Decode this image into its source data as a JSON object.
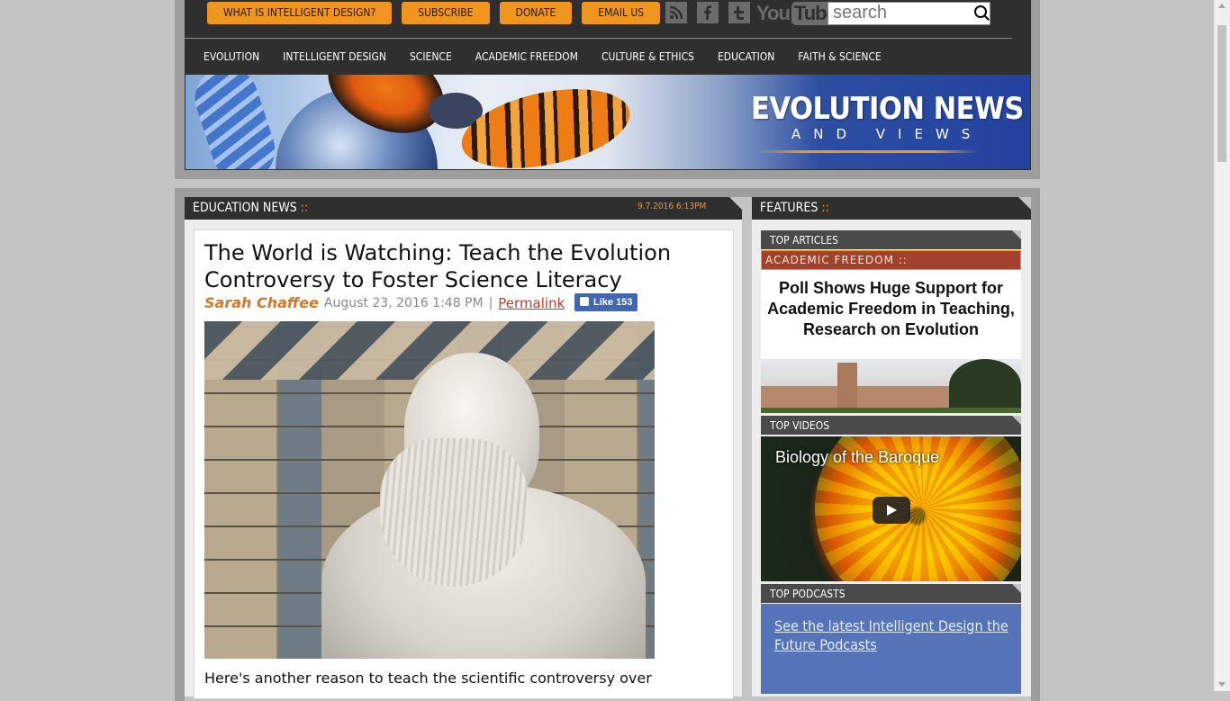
{
  "header": {
    "top_buttons": [
      "WHAT IS INTELLIGENT DESIGN?",
      "SUBSCRIBE",
      "DONATE",
      "EMAIL US"
    ],
    "social_icons": [
      "rss-icon",
      "facebook-icon",
      "twitter-icon",
      "youtube-icon"
    ],
    "youtube": {
      "you": "You",
      "tube": "Tube"
    },
    "search": {
      "placeholder": "search"
    },
    "nav": [
      "EVOLUTION",
      "INTELLIGENT DESIGN",
      "SCIENCE",
      "ACADEMIC FREEDOM",
      "CULTURE & ETHICS",
      "EDUCATION",
      "FAITH & SCIENCE"
    ],
    "banner": {
      "title": "EVOLUTION NEWS",
      "subtitle": "AND VIEWS"
    }
  },
  "main": {
    "section_title": "EDUCATION NEWS",
    "section_dots": "::",
    "timestamp": "9.7.2016 6:13PM",
    "article": {
      "title": "The World is Watching: Teach the Evolution Controversy to Foster Science Literacy",
      "author": "Sarah Chaffee",
      "date": "August 23, 2016 1:48 PM",
      "separator": "|",
      "permalink": "Permalink",
      "fb_like": "Like 153",
      "body_start": "Here's another reason to teach the scientific controversy over"
    }
  },
  "sidebar": {
    "section_title": "FEATURES",
    "section_dots": "::",
    "top_articles": {
      "label": "TOP ARTICLES",
      "category": "ACADEMIC FREEDOM ::",
      "headline": "Poll Shows Huge Support for Academic Freedom in Teaching, Research on Evolution"
    },
    "top_videos": {
      "label": "TOP VIDEOS",
      "video_title": "Biology of the Baroque"
    },
    "top_podcasts": {
      "label": "TOP PODCASTS",
      "link": "See the latest Intelligent Design the Future Podcasts"
    }
  },
  "colors": {
    "accent_orange": "#f0961e",
    "header_dark": "#2f2f2f",
    "banner_blue": "#2342a0",
    "podcast_blue": "#5573b8",
    "author_orange": "#d2782a"
  }
}
